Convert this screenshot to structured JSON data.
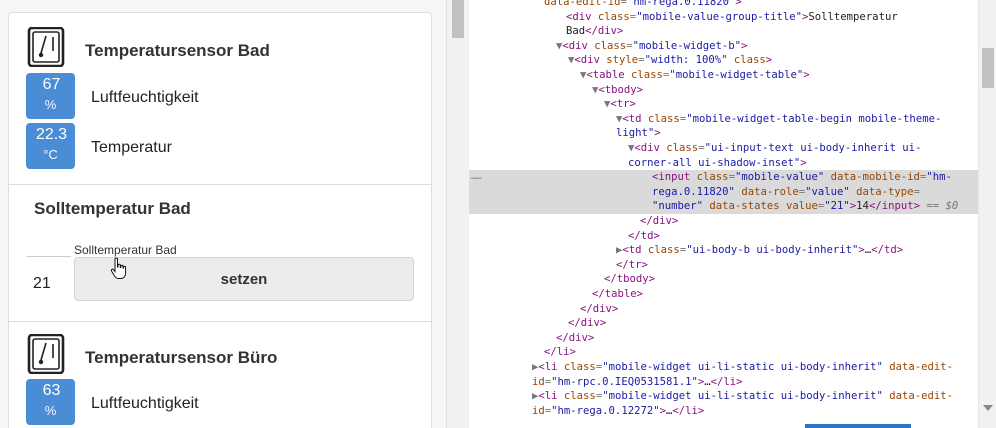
{
  "app": {
    "devices": [
      {
        "title": "Temperatursensor Bad",
        "rows": [
          {
            "value": "67",
            "unit": "%",
            "label": "Luftfeuchtigkeit"
          },
          {
            "value": "22.3",
            "unit": "°C",
            "label": "Temperatur"
          }
        ]
      },
      {
        "title": "Temperatursensor Büro",
        "rows": [
          {
            "value": "63",
            "unit": "%",
            "label": "Luftfeuchtigkeit"
          }
        ]
      }
    ],
    "setpoint_group": {
      "title": "Solltemperatur Bad",
      "value_title": "Solltemperatur Bad",
      "input_value": "21",
      "button_label": "setzen"
    },
    "colors": {
      "badge": "#4a8cd6",
      "button": "#ececec"
    }
  },
  "devtools": {
    "selected_marker": "…",
    "lines": [
      "data-edit-id=\"hm-rega.0.11820\">",
      "<div class=\"mobile-value-group-title\">Solltemperatur",
      "Bad</div>",
      "▼<div class=\"mobile-widget-b\">",
      "▼<div style=\"width: 100%\" class>",
      "▼<table class=\"mobile-widget-table\">",
      "▼<tbody>",
      "▼<tr>",
      "▼<td class=\"mobile-widget-table-begin mobile-theme-",
      "light\">",
      "▼<div class=\"ui-input-text ui-body-inherit ui-",
      "corner-all ui-shadow-inset\">",
      "<input class=\"mobile-value\" data-mobile-id=\"hm-",
      "rega.0.11820\" data-role=\"value\" data-type=",
      "\"number\" data-states value=\"21\">14</input> == $0",
      "</div>",
      "</td>",
      "▶<td class=\"ui-body-b ui-body-inherit\">…</td>",
      "</tr>",
      "</tbody>",
      "</table>",
      "</div>",
      "</div>",
      "</div>",
      "</li>",
      "▶<li class=\"mobile-widget ui-li-static ui-body-inherit\" data-edit-",
      "id=\"hm-rpc.0.IEQ0531581.1\">…</li>",
      "▶<li class=\"mobile-widget ui-li-static ui-body-inherit\" data-edit-",
      "id=\"hm-rega.0.12272\">…</li>"
    ]
  }
}
